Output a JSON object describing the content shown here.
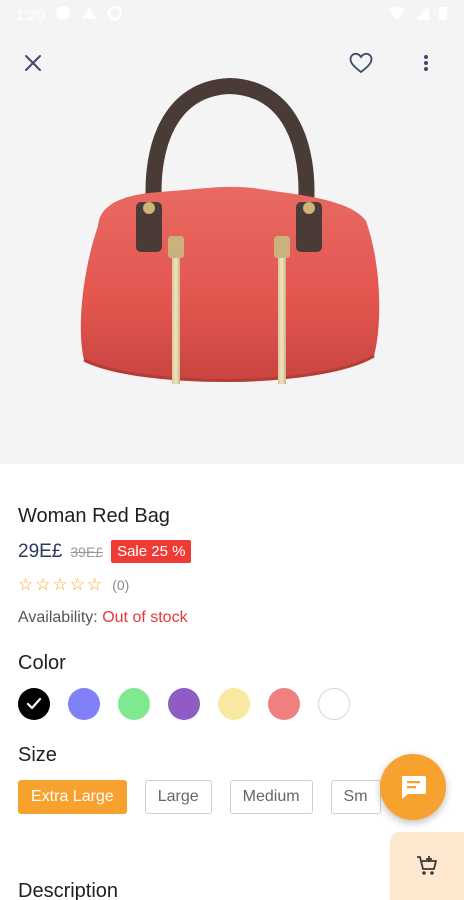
{
  "status_bar": {
    "time": "1:20"
  },
  "product": {
    "name": "Woman Red Bag",
    "price": "29E£",
    "old_price": "39E£",
    "sale_badge": "Sale 25 %",
    "stars": "☆☆☆☆☆",
    "rating_count": "(0)",
    "availability_label": "Availability:",
    "availability_value": "Out of stock"
  },
  "color_section": {
    "label": "Color",
    "swatches": [
      "#000000",
      "#8080f8",
      "#80e890",
      "#8e5cc4",
      "#f8e8a0",
      "#ee8080",
      "#ffffff"
    ]
  },
  "size_section": {
    "label": "Size",
    "options": [
      "Extra Large",
      "Large",
      "Medium",
      "Sm"
    ]
  },
  "description_label": "Description",
  "accent_color": "#f7a12e",
  "icons": [
    "close-icon",
    "heart-icon",
    "more-vertical-icon",
    "chat-icon",
    "cart-icon",
    "check-icon",
    "wifi-icon",
    "signal-icon",
    "battery-icon"
  ]
}
